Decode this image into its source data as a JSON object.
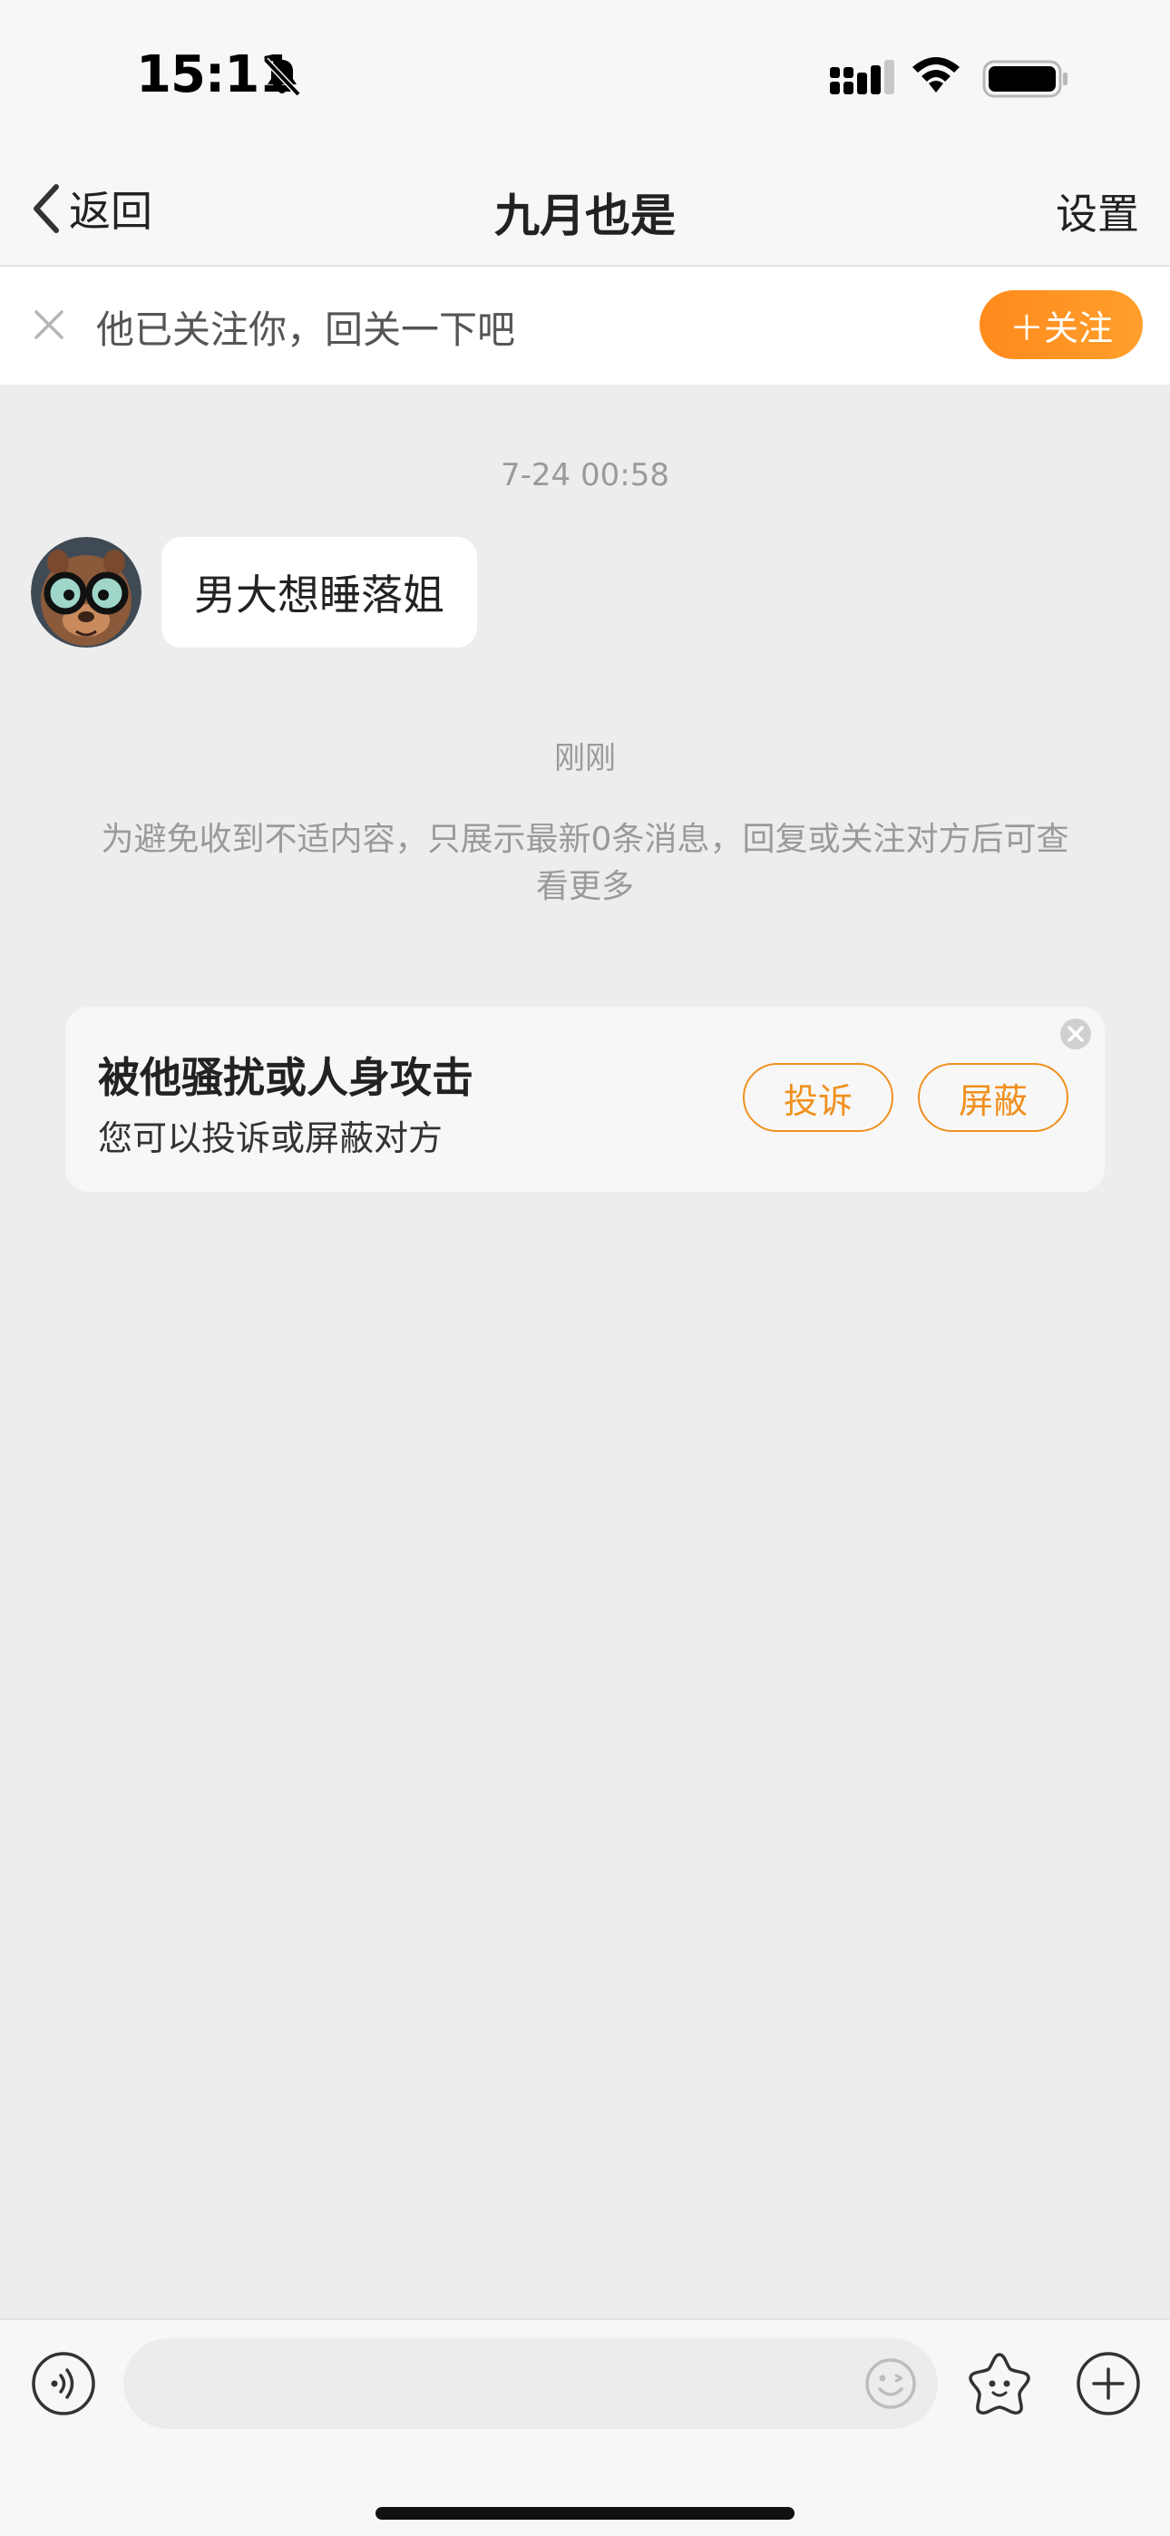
{
  "status_bar": {
    "time": "15:11",
    "icons": [
      "bell-muted-icon",
      "signal-icon",
      "wifi-icon",
      "battery-icon"
    ]
  },
  "nav": {
    "back_label": "返回",
    "title": "九月也是",
    "settings_label": "设置"
  },
  "follow_banner": {
    "text": "他已关注你，回关一下吧",
    "button_label": "＋关注"
  },
  "chat": {
    "messages": [
      {
        "timestamp": "7-24 00:58",
        "sender": "other",
        "text": "男大想睡落姐"
      }
    ],
    "system_time": "刚刚",
    "notice": "为避免收到不适内容，只展示最新0条消息，回复或关注对方后可查看更多"
  },
  "harassment_card": {
    "title": "被他骚扰或人身攻击",
    "subtitle": "您可以投诉或屏蔽对方",
    "report_label": "投诉",
    "block_label": "屏蔽"
  },
  "input_bar": {
    "placeholder": "",
    "icons": [
      "voice-icon",
      "emoji-icon",
      "sticker-icon",
      "plus-icon"
    ]
  },
  "colors": {
    "accent": "#ff9a28",
    "background": "#ededed",
    "bar_background": "#f7f7f7"
  }
}
